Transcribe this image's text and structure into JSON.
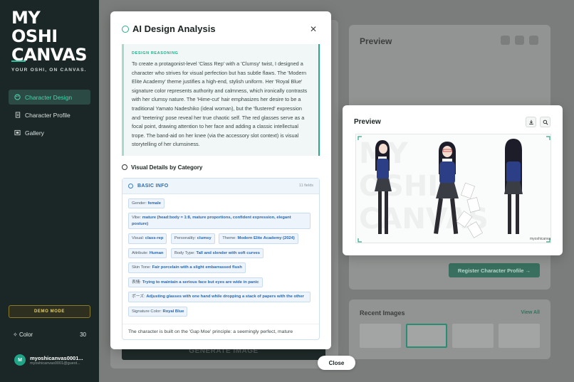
{
  "sidebar": {
    "logo_lines": [
      "MY",
      "OSHI",
      "CANVAS"
    ],
    "tagline": "YOUR OSHI, ON CANVAS.",
    "nav": [
      {
        "label": "Character Design",
        "icon": "palette-icon",
        "active": true
      },
      {
        "label": "Character Profile",
        "icon": "document-icon",
        "active": false
      },
      {
        "label": "Gallery",
        "icon": "gallery-icon",
        "active": false
      }
    ],
    "demo_mode": "DEMO MODE",
    "color_label": "Color",
    "color_count": "30",
    "user": {
      "initial": "M",
      "name": "myoshicanvas0001...",
      "email": "myoshicanvas0001@guest..."
    }
  },
  "background": {
    "preview_title": "Preview",
    "register_button": "Register Character Profile",
    "recent_images_title": "Recent Images",
    "view_all": "View All",
    "generate_button": "GENERATE IMAGE"
  },
  "modal": {
    "title": "AI Design Analysis",
    "reasoning_label": "DESIGN REASONING",
    "reasoning_text": "To create a protagonist-level 'Class Rep' with a 'Clumsy' twist, I designed a character who strives for visual perfection but has subtle flaws. The 'Modern Elite Academy' theme justifies a high-end, stylish uniform. Her 'Royal Blue' signature color represents authority and calmness, which ironically contrasts with her clumsy nature. The 'Hime-cut' hair emphasizes her desire to be a traditional Yamato Nadeshiko (ideal woman), but the 'flustered' expression and 'teetering' pose reveal her true chaotic self. The red glasses serve as a focal point, drawing attention to her face and adding a classic intellectual trope. The band-aid on her knee (via the accessory slot context) is visual storytelling of her clumsiness.",
    "visual_details_title": "Visual Details by Category",
    "basic_info": {
      "title": "BASIC INFO",
      "field_count": "11 fields",
      "fields": [
        {
          "label": "Gender:",
          "value": "female"
        },
        {
          "label": "Vibe:",
          "value": "mature (head:body = 1:8, mature proportions, confident expression, elegant posture)"
        },
        {
          "label": "Visual:",
          "value": "class-rep"
        },
        {
          "label": "Personality:",
          "value": "clumsy"
        },
        {
          "label": "Theme:",
          "value": "Modern Elite Academy (2024)"
        },
        {
          "label": "Attribute:",
          "value": "Human"
        },
        {
          "label": "Body Type:",
          "value": "Tall and slender with soft curves"
        },
        {
          "label": "Skin Tone:",
          "value": "Fair porcelain with a slight embarrassed flush"
        },
        {
          "label": "表情:",
          "value": "Trying to maintain a serious face but eyes are wide in panic"
        },
        {
          "label": "ポーズ:",
          "value": "Adjusting glasses with one hand while dropping a stack of papers with the other"
        },
        {
          "label": "Signature Color:",
          "value": "Royal Blue"
        }
      ]
    },
    "summary_text": "The character is built on the 'Gap Moe' principle: a seemingly perfect, mature",
    "close_button": "Close"
  },
  "preview_popup": {
    "title": "Preview",
    "watermark": "MY OSHI CANVAS",
    "signature": "myoshicanvas",
    "download_icon": "download-icon",
    "zoom_icon": "zoom-icon"
  },
  "colors": {
    "sidebar_bg": "#1b2726",
    "accent": "#2aaa8a",
    "tag_blue": "#2a67ad",
    "demo_gold": "#e5cf5f"
  }
}
